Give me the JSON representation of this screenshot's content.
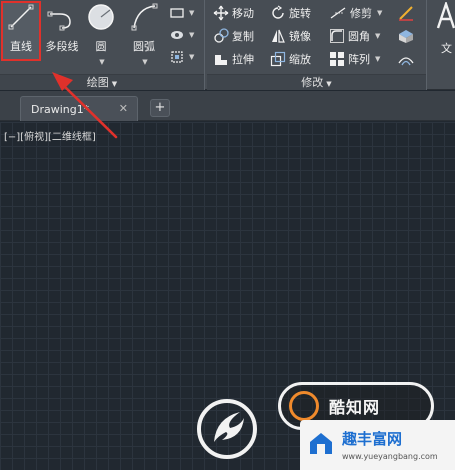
{
  "ribbon": {
    "draw_panel": {
      "title": "绘图",
      "tools": {
        "line": "直线",
        "polyline": "多段线",
        "circle": "圆",
        "arc": "圆弧"
      }
    },
    "modify_panel": {
      "title": "修改",
      "tools": {
        "move": "移动",
        "rotate": "旋转",
        "trim": "修剪",
        "copy": "复制",
        "mirror": "镜像",
        "fillet": "圆角",
        "stretch": "拉伸",
        "scale": "缩放",
        "array": "阵列"
      }
    },
    "annotation_partial": "文"
  },
  "tabs": {
    "document": "Drawing1*",
    "close": "✕",
    "new": "+"
  },
  "viewport": {
    "label": "[−][俯视][二维线框]"
  },
  "colors": {
    "highlight": "#e0312b",
    "canvas": "#212830",
    "ribbon": "#474d54"
  },
  "watermark": {
    "badge_text": "酷知网",
    "site_title": "趣丰富网",
    "site_url": "www.yueyangbang.com"
  }
}
